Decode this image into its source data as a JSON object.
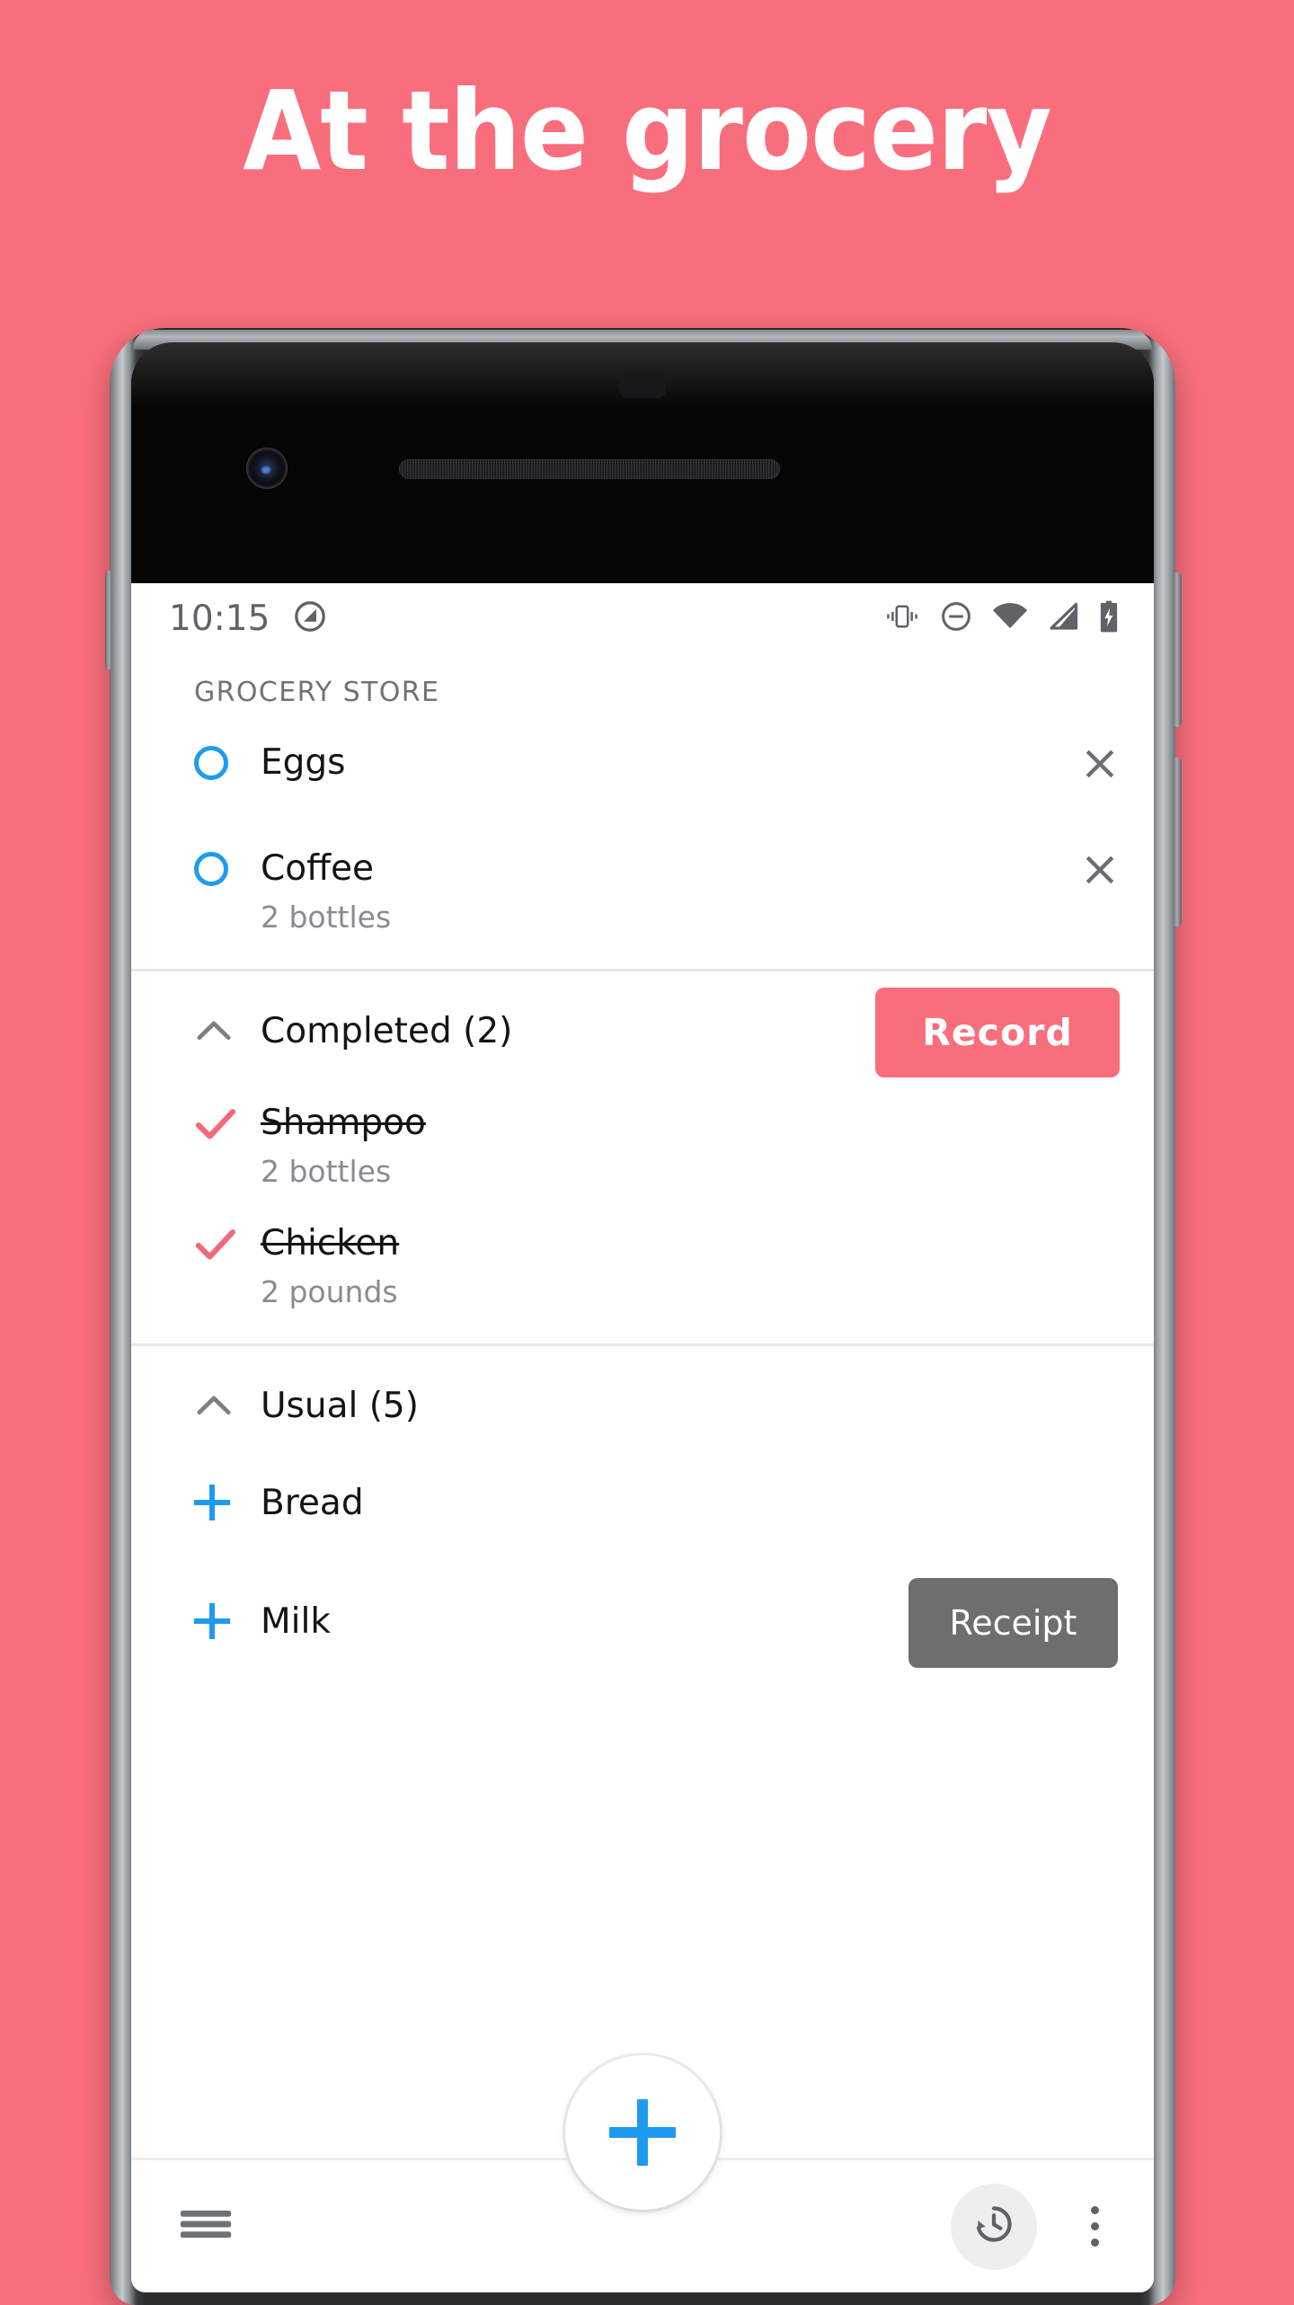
{
  "promo": {
    "headline": "At the grocery",
    "background_color": "#f96e7c"
  },
  "status_bar": {
    "time": "10:15",
    "left_icons": [
      "do-not-disturb-shape-icon"
    ],
    "right_icons": [
      "vibrate-icon",
      "do-not-disturb-icon",
      "wifi-icon",
      "cell-signal-icon",
      "battery-charging-icon"
    ]
  },
  "app": {
    "list_header": "GROCERY STORE",
    "accent_blue": "#1e9bf0",
    "accent_pink": "#f96e7c",
    "active_items": [
      {
        "title": "Eggs",
        "subtitle": "",
        "checkbox": "unchecked",
        "delete_label": "×"
      },
      {
        "title": "Coffee",
        "subtitle": "2 bottles",
        "checkbox": "unchecked",
        "delete_label": "×"
      }
    ],
    "completed_group": {
      "label": "Completed (2)",
      "chevron": "chevron-up-icon",
      "items": [
        {
          "title": "Shampoo",
          "subtitle": "2 bottles"
        },
        {
          "title": "Chicken",
          "subtitle": "2 pounds"
        }
      ]
    },
    "usual_group": {
      "label": "Usual (5)",
      "chevron": "chevron-up-icon",
      "items": [
        {
          "title": "Bread",
          "subtitle": ""
        },
        {
          "title": "Milk",
          "subtitle": ""
        }
      ]
    },
    "tooltips": {
      "record": "Record",
      "receipt": "Receipt"
    },
    "bottom_bar": {
      "menu_icon": "hamburger-menu-icon",
      "history_icon": "history-icon",
      "overflow_icon": "overflow-menu-icon",
      "fab_icon": "plus-icon"
    }
  }
}
